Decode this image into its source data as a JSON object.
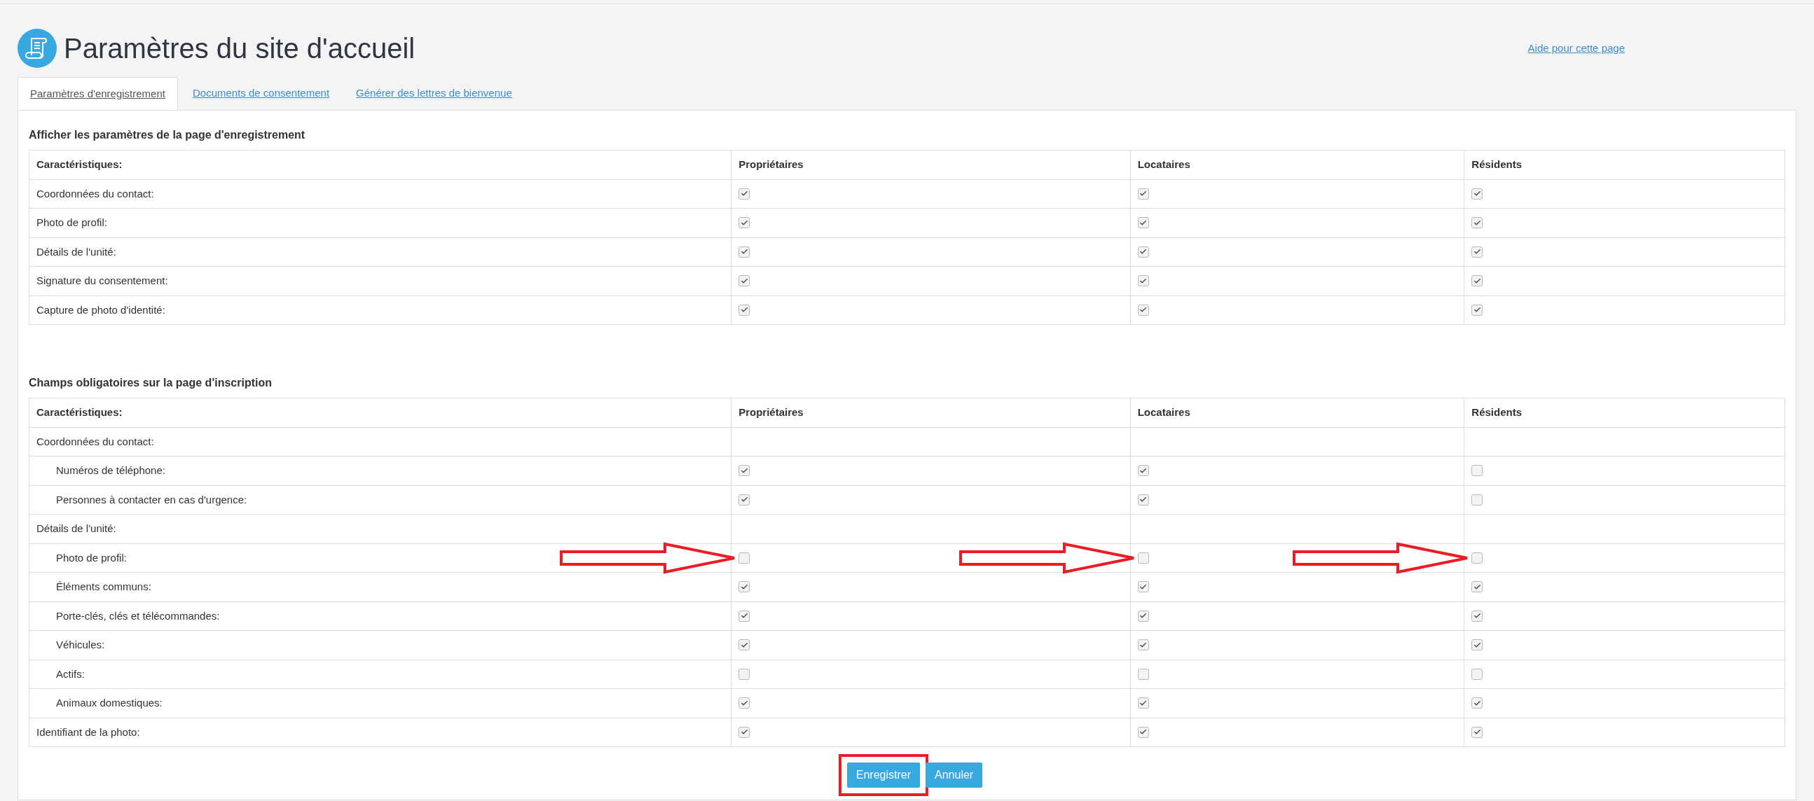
{
  "page": {
    "title": "Paramètres du site d'accueil",
    "help_link": "Aide pour cette page"
  },
  "tabs": [
    {
      "label": "Paramètres d'enregistrement",
      "selected": true
    },
    {
      "label": "Documents de consentement",
      "selected": false
    },
    {
      "label": "Générer des lettres de bienvenue",
      "selected": false
    }
  ],
  "sections": [
    {
      "title": "Afficher les paramètres de la page d'enregistrement",
      "columns": [
        "Caractéristiques:",
        "Propriétaires",
        "Locataires",
        "Résidents"
      ],
      "rows": [
        {
          "label": "Coordonnées du contact:",
          "checks": [
            true,
            true,
            true
          ]
        },
        {
          "label": "Photo de profil:",
          "checks": [
            true,
            true,
            true
          ]
        },
        {
          "label": "Détails de l'unité:",
          "checks": [
            true,
            true,
            true
          ]
        },
        {
          "label": "Signature du consentement:",
          "checks": [
            true,
            true,
            true
          ]
        },
        {
          "label": "Capture de photo d'identité:",
          "checks": [
            true,
            true,
            true
          ]
        }
      ]
    },
    {
      "title": "Champs obligatoires sur la page d'inscription",
      "columns": [
        "Caractéristiques:",
        "Propriétaires",
        "Locataires",
        "Résidents"
      ],
      "rows": [
        {
          "label": "Coordonnées du contact:",
          "children": [
            {
              "label": "Numéros de téléphone:",
              "checks": [
                true,
                true,
                false
              ]
            },
            {
              "label": "Personnes à contacter en cas d'urgence:",
              "checks": [
                true,
                true,
                false
              ]
            }
          ]
        },
        {
          "label": "Détails de l'unité:",
          "children": [
            {
              "label": "Photo de profil:",
              "checks": [
                false,
                false,
                false
              ],
              "arrow_marked": true
            },
            {
              "label": "Éléments communs:",
              "checks": [
                true,
                true,
                true
              ]
            },
            {
              "label": "Porte-clés, clés et télécommandes:",
              "checks": [
                true,
                true,
                true
              ]
            },
            {
              "label": "Véhicules:",
              "checks": [
                true,
                true,
                true
              ]
            },
            {
              "label": "Actifs:",
              "checks": [
                false,
                false,
                false
              ]
            },
            {
              "label": "Animaux domestiques:",
              "checks": [
                true,
                true,
                true
              ]
            }
          ]
        },
        {
          "label": "Identifiant de la photo:",
          "checks": [
            true,
            true,
            true
          ]
        }
      ]
    }
  ],
  "buttons": [
    {
      "label": "Enregistrer",
      "highlighted": true
    },
    {
      "label": "Annuler",
      "highlighted": false
    }
  ]
}
